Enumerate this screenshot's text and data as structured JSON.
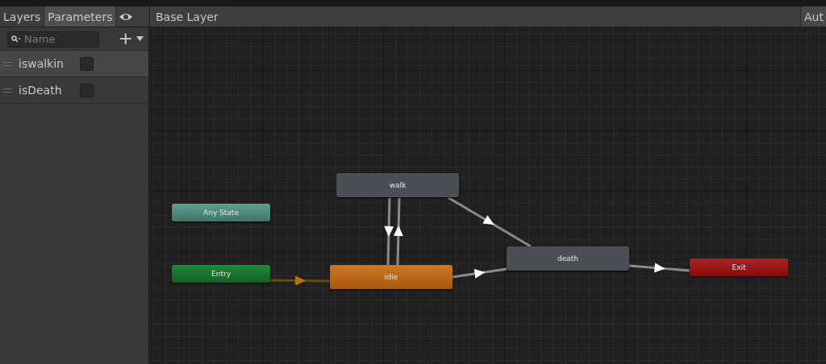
{
  "toolbar": {
    "tabs": [
      {
        "label": "Layers",
        "selected": false
      },
      {
        "label": "Parameters",
        "selected": true
      }
    ],
    "breadcrumb": "Base Layer",
    "auto_button": "Aut"
  },
  "parameters": {
    "search": {
      "placeholder": "Name"
    },
    "add_button": "+",
    "items": [
      {
        "name": "iswalkin",
        "selected": true,
        "checked": false
      },
      {
        "name": "isDeath",
        "selected": false,
        "checked": false
      }
    ]
  },
  "graph": {
    "nodes": [
      {
        "label": "Any State",
        "kind": "any"
      },
      {
        "label": "Entry",
        "kind": "entry"
      },
      {
        "label": "walk",
        "kind": "state"
      },
      {
        "label": "idle",
        "kind": "default"
      },
      {
        "label": "death",
        "kind": "state"
      },
      {
        "label": "Exit",
        "kind": "exit"
      }
    ]
  }
}
